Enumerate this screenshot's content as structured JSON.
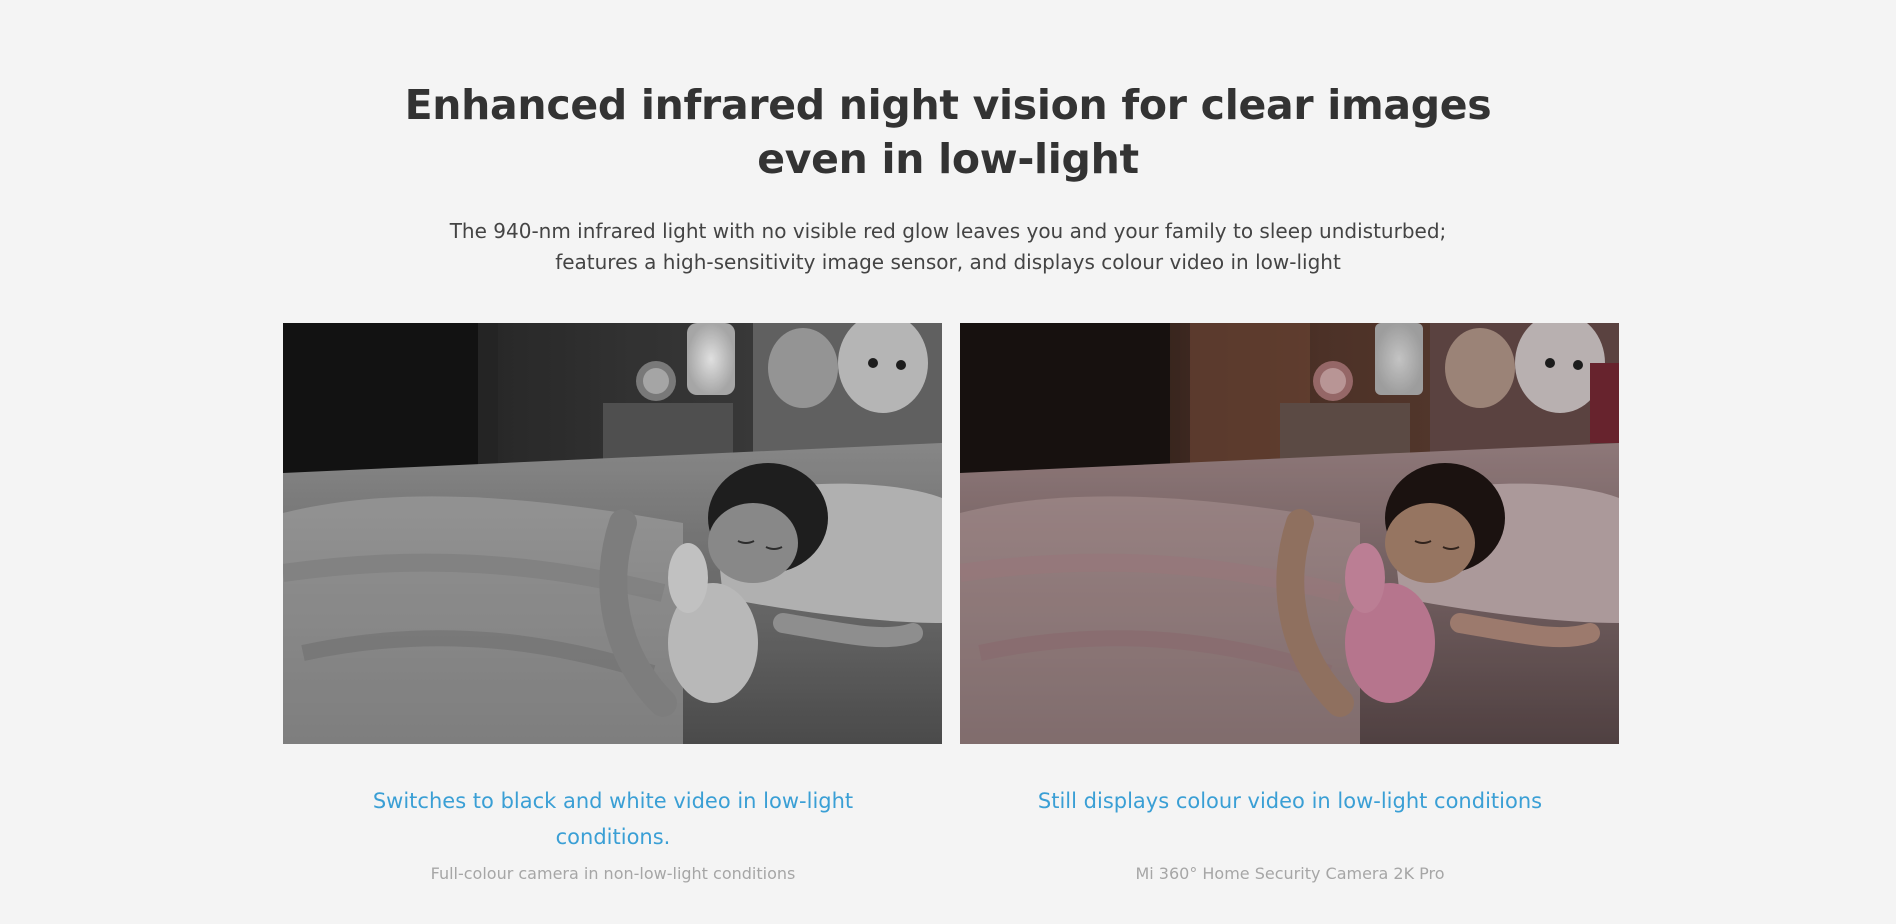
{
  "section": {
    "headline": "Enhanced infrared night vision for clear images even in low-light",
    "description_line_1": "The 940-nm infrared light with no visible red glow leaves you and your family to sleep undisturbed;",
    "description_line_2": "features a high-sensitivity image sensor, and displays colour video in low-light"
  },
  "comparison": [
    {
      "image_style": "black-and-white",
      "title": "Switches to black and white video in low-light conditions.",
      "note": "Full-colour camera in non-low-light conditions"
    },
    {
      "image_style": "colour",
      "title": "Still displays colour video in low-light conditions",
      "note": "Mi 360° Home Security Camera 2K Pro"
    }
  ],
  "colors": {
    "background": "#f4f4f4",
    "heading": "#333333",
    "accent": "#3a9fd5",
    "muted": "#a6a6a6"
  }
}
